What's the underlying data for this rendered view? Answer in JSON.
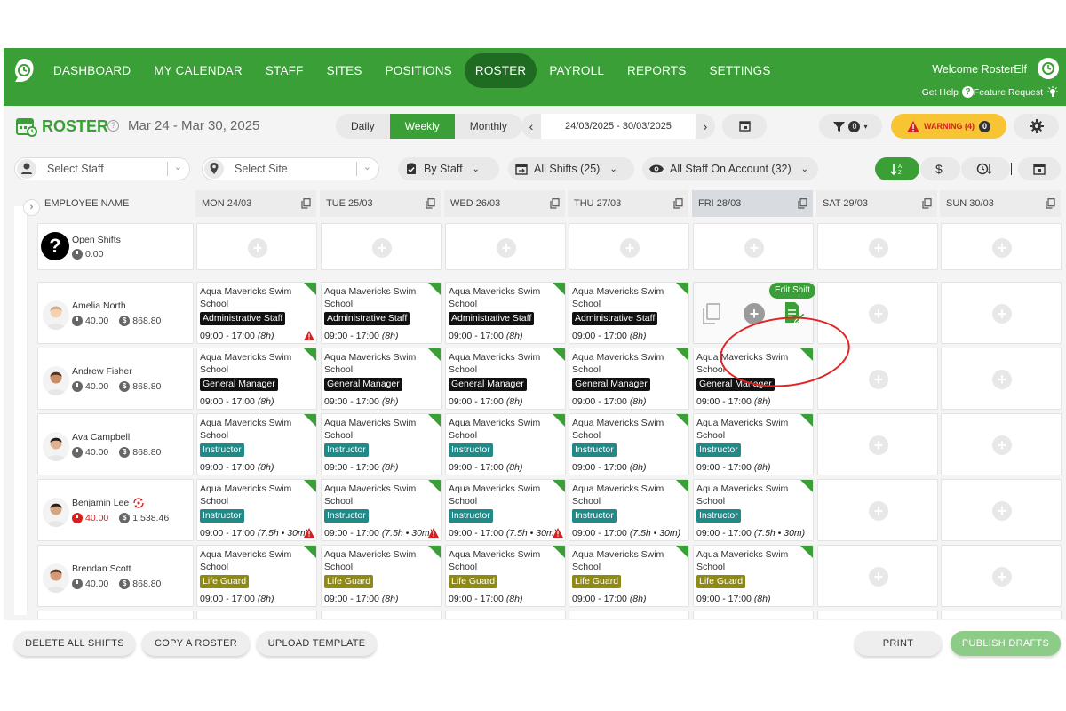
{
  "colors": {
    "brand": "#3a9f37",
    "brand_dark": "#1f6b22",
    "warning": "#f7c534",
    "alert": "#d42020",
    "admin": "#111111",
    "instructor": "#1f8a88",
    "lifeguard": "#8f8a13"
  },
  "nav": {
    "items": [
      "DASHBOARD",
      "MY CALENDAR",
      "STAFF",
      "SITES",
      "POSITIONS",
      "ROSTER",
      "PAYROLL",
      "REPORTS",
      "SETTINGS"
    ],
    "active": "ROSTER",
    "welcome": "Welcome RosterElf",
    "get_help": "Get Help",
    "feature_request": "Feature Request"
  },
  "header": {
    "title": "ROSTER",
    "date_range": "Mar 24 - Mar 30, 2025",
    "views": [
      "Daily",
      "Weekly",
      "Monthly"
    ],
    "active_view": "Weekly",
    "date_field": "24/03/2025 - 30/03/2025",
    "filter_count": "0",
    "warning_label": "WARNING (4)",
    "warning_count": "0"
  },
  "filters": {
    "staff_placeholder": "Select Staff",
    "site_placeholder": "Select Site",
    "group_by": "By Staff",
    "shifts": "All Shifts (25)",
    "staff_scope": "All Staff On Account (32)"
  },
  "grid": {
    "employee_header": "EMPLOYEE NAME",
    "days": [
      "MON 24/03",
      "TUE 25/03",
      "WED 26/03",
      "THU 27/03",
      "FRI 28/03",
      "SAT 29/03",
      "SUN 30/03"
    ],
    "open_shifts": {
      "label": "Open Shifts",
      "hours": "0.00"
    },
    "edit_tooltip": "Edit Shift",
    "employees": [
      {
        "name": "Amelia North",
        "hours": "40.00",
        "cost": "868.80",
        "hours_alert": false,
        "repeat_icon": false,
        "shifts": [
          {
            "site": "Aqua Mavericks Swim School",
            "position": "Administrative Staff",
            "pos_class": "admin",
            "time": "09:00 - 17:00",
            "dur": "(8h)",
            "warn": true
          },
          {
            "site": "Aqua Mavericks Swim School",
            "position": "Administrative Staff",
            "pos_class": "admin",
            "time": "09:00 - 17:00",
            "dur": "(8h)",
            "warn": false
          },
          {
            "site": "Aqua Mavericks Swim School",
            "position": "Administrative Staff",
            "pos_class": "admin",
            "time": "09:00 - 17:00",
            "dur": "(8h)",
            "warn": false
          },
          {
            "site": "Aqua Mavericks Swim School",
            "position": "Administrative Staff",
            "pos_class": "admin",
            "time": "09:00 - 17:00",
            "dur": "(8h)",
            "warn": false
          },
          "hover",
          null,
          null
        ]
      },
      {
        "name": "Andrew Fisher",
        "hours": "40.00",
        "cost": "868.80",
        "hours_alert": false,
        "repeat_icon": false,
        "shifts": [
          {
            "site": "Aqua Mavericks Swim School",
            "position": "General Manager",
            "pos_class": "gm",
            "time": "09:00 - 17:00",
            "dur": "(8h)",
            "warn": false
          },
          {
            "site": "Aqua Mavericks Swim School",
            "position": "General Manager",
            "pos_class": "gm",
            "time": "09:00 - 17:00",
            "dur": "(8h)",
            "warn": false
          },
          {
            "site": "Aqua Mavericks Swim School",
            "position": "General Manager",
            "pos_class": "gm",
            "time": "09:00 - 17:00",
            "dur": "(8h)",
            "warn": false
          },
          {
            "site": "Aqua Mavericks Swim School",
            "position": "General Manager",
            "pos_class": "gm",
            "time": "09:00 - 17:00",
            "dur": "(8h)",
            "warn": false
          },
          {
            "site": "Aqua Mavericks Swim School",
            "position": "General Manager",
            "pos_class": "gm",
            "time": "09:00 - 17:00",
            "dur": "(8h)",
            "warn": false
          },
          null,
          null
        ]
      },
      {
        "name": "Ava Campbell",
        "hours": "40.00",
        "cost": "868.80",
        "hours_alert": false,
        "repeat_icon": false,
        "shifts": [
          {
            "site": "Aqua Mavericks Swim School",
            "position": "Instructor",
            "pos_class": "instructor",
            "time": "09:00 - 17:00",
            "dur": "(8h)",
            "warn": false
          },
          {
            "site": "Aqua Mavericks Swim School",
            "position": "Instructor",
            "pos_class": "instructor",
            "time": "09:00 - 17:00",
            "dur": "(8h)",
            "warn": false
          },
          {
            "site": "Aqua Mavericks Swim School",
            "position": "Instructor",
            "pos_class": "instructor",
            "time": "09:00 - 17:00",
            "dur": "(8h)",
            "warn": false
          },
          {
            "site": "Aqua Mavericks Swim School",
            "position": "Instructor",
            "pos_class": "instructor",
            "time": "09:00 - 17:00",
            "dur": "(8h)",
            "warn": false
          },
          {
            "site": "Aqua Mavericks Swim School",
            "position": "Instructor",
            "pos_class": "instructor",
            "time": "09:00 - 17:00",
            "dur": "(8h)",
            "warn": false
          },
          null,
          null
        ]
      },
      {
        "name": "Benjamin Lee",
        "hours": "40.00",
        "cost": "1,538.46",
        "hours_alert": true,
        "repeat_icon": true,
        "shifts": [
          {
            "site": "Aqua Mavericks Swim School",
            "position": "Instructor",
            "pos_class": "instructor",
            "time": "09:00 - 17:00",
            "dur": "(7.5h • 30m)",
            "warn": true
          },
          {
            "site": "Aqua Mavericks Swim School",
            "position": "Instructor",
            "pos_class": "instructor",
            "time": "09:00 - 17:00",
            "dur": "(7.5h • 30m)",
            "warn": true
          },
          {
            "site": "Aqua Mavericks Swim School",
            "position": "Instructor",
            "pos_class": "instructor",
            "time": "09:00 - 17:00",
            "dur": "(7.5h • 30m)",
            "warn": true
          },
          {
            "site": "Aqua Mavericks Swim School",
            "position": "Instructor",
            "pos_class": "instructor",
            "time": "09:00 - 17:00",
            "dur": "(7.5h • 30m)",
            "warn": false
          },
          {
            "site": "Aqua Mavericks Swim School",
            "position": "Instructor",
            "pos_class": "instructor",
            "time": "09:00 - 17:00",
            "dur": "(7.5h • 30m)",
            "warn": false
          },
          null,
          null
        ]
      },
      {
        "name": "Brendan Scott",
        "hours": "40.00",
        "cost": "868.80",
        "hours_alert": false,
        "repeat_icon": false,
        "shifts": [
          {
            "site": "Aqua Mavericks Swim School",
            "position": "Life Guard",
            "pos_class": "lifeguard",
            "time": "09:00 - 17:00",
            "dur": "(8h)",
            "warn": false
          },
          {
            "site": "Aqua Mavericks Swim School",
            "position": "Life Guard",
            "pos_class": "lifeguard",
            "time": "09:00 - 17:00",
            "dur": "(8h)",
            "warn": false
          },
          {
            "site": "Aqua Mavericks Swim School",
            "position": "Life Guard",
            "pos_class": "lifeguard",
            "time": "09:00 - 17:00",
            "dur": "(8h)",
            "warn": false
          },
          {
            "site": "Aqua Mavericks Swim School",
            "position": "Life Guard",
            "pos_class": "lifeguard",
            "time": "09:00 - 17:00",
            "dur": "(8h)",
            "warn": false
          },
          {
            "site": "Aqua Mavericks Swim School",
            "position": "Life Guard",
            "pos_class": "lifeguard",
            "time": "09:00 - 17:00",
            "dur": "(8h)",
            "warn": false
          },
          null,
          null
        ]
      }
    ]
  },
  "footer": {
    "delete_all": "DELETE ALL SHIFTS",
    "copy_roster": "COPY A ROSTER",
    "upload_template": "UPLOAD TEMPLATE",
    "print": "PRINT",
    "publish": "PUBLISH DRAFTS"
  }
}
